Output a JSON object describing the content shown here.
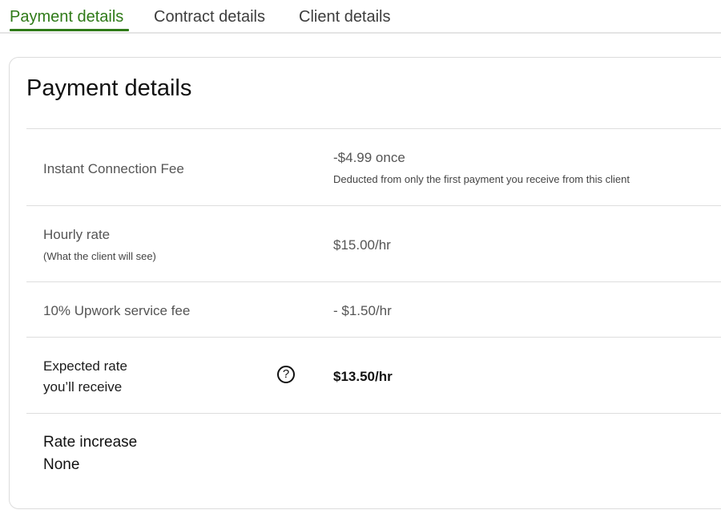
{
  "tabs": [
    {
      "label": "Payment details",
      "active": true
    },
    {
      "label": "Contract details",
      "active": false
    },
    {
      "label": "Client details",
      "active": false
    }
  ],
  "colors": {
    "accent": "#2f7a18",
    "divider": "#dedede"
  },
  "card": {
    "title": "Payment details"
  },
  "rows": {
    "connection_fee": {
      "label": "Instant Connection Fee",
      "value": "-$4.99 once",
      "note": "Deducted from only the first payment you receive from this client"
    },
    "hourly_rate": {
      "label": "Hourly rate",
      "sublabel": "(What the client will see)",
      "value": "$15.00/hr"
    },
    "service_fee": {
      "label": "10% Upwork service fee",
      "value": "- $1.50/hr"
    },
    "expected_rate": {
      "label_line1": "Expected rate",
      "label_line2": "you’ll receive",
      "help_icon": "question-circle-icon",
      "help_glyph": "?",
      "value": "$13.50/hr"
    },
    "rate_increase": {
      "label": "Rate increase",
      "value": "None"
    }
  }
}
